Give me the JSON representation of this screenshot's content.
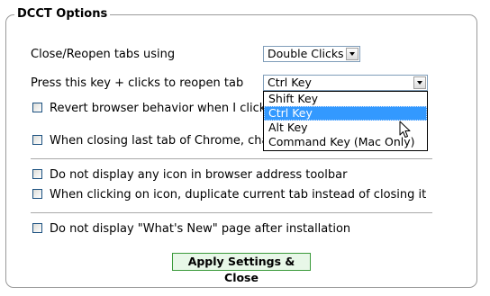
{
  "panel": {
    "legend": "DCCT Options"
  },
  "close_reopen": {
    "label": "Close/Reopen tabs using",
    "selected": "Double Clicks"
  },
  "reopen_key": {
    "label": "Press this key + clicks to reopen tab",
    "selected": "Ctrl Key",
    "options": [
      "Shift Key",
      "Ctrl Key",
      "Alt Key",
      "Command Key (Mac Only)"
    ],
    "highlighted_option": "Ctrl Key"
  },
  "checkboxes": {
    "revert": {
      "label": "Revert browser behavior when I click",
      "checked": false
    },
    "last_tab": {
      "label": "When closing last tab of Chrome, char",
      "checked": false
    },
    "no_icon": {
      "label": "Do not display any icon in browser address toolbar",
      "checked": false
    },
    "duplicate": {
      "label": "When clicking on icon, duplicate current tab instead of closing it",
      "checked": false
    },
    "whats_new": {
      "label": "Do not display \"What's New\" page after installation",
      "checked": false
    }
  },
  "buttons": {
    "apply_label": "Apply Settings & Close"
  },
  "icons": {
    "dropdown_arrow": "chevron-down-icon",
    "cursor": "mouse-pointer-icon"
  },
  "colors": {
    "highlight": "#3399ff",
    "apply_button_bg": "#e8f7e8",
    "apply_button_border": "#3a9a3a"
  }
}
